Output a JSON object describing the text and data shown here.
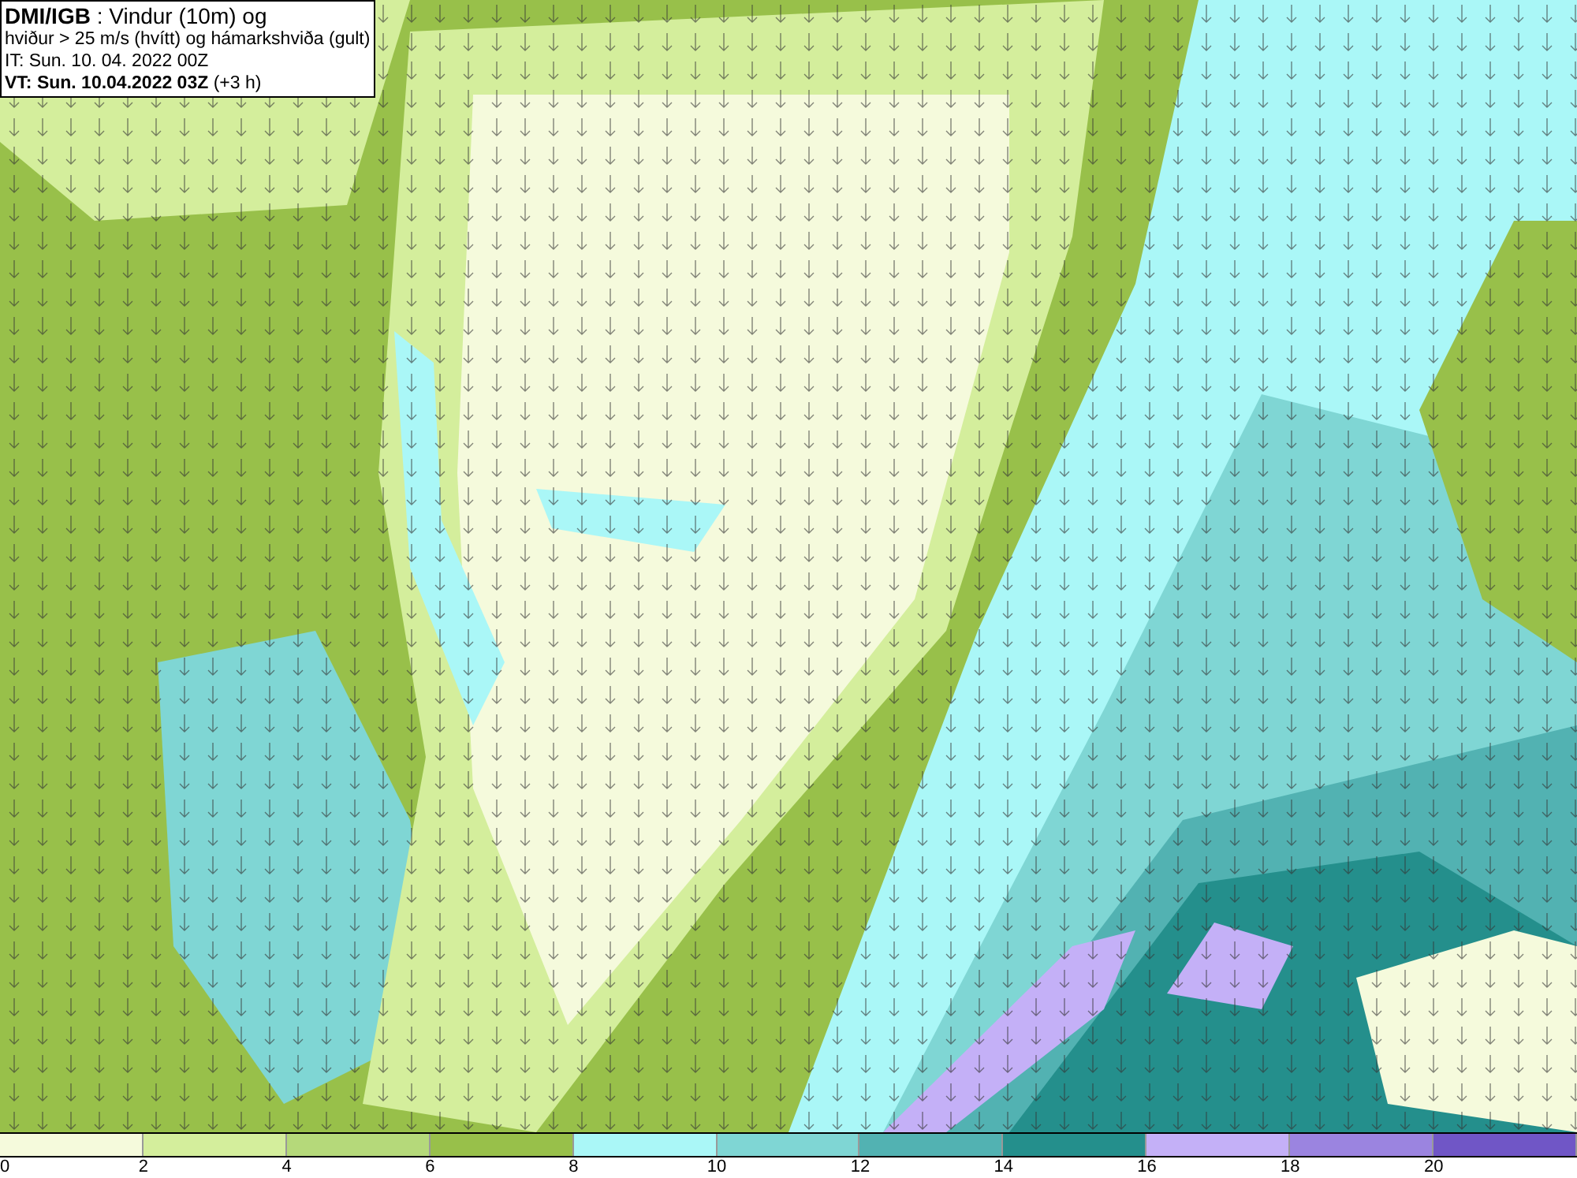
{
  "title_box": {
    "lines": [
      "**DMI/IGB** : Vindur (10m) og",
      "hviður > 25 m/s (hvítt) og hámarkshviða (gult)",
      "IT: Sun. 10. 04. 2022 00Z",
      "**VT: Sun. 10.04.2022 03Z** (+3 h)"
    ]
  },
  "legend": {
    "segments": [
      {
        "color": "#f5fadc"
      },
      {
        "color": "#d4ee9c"
      },
      {
        "color": "#b5d97a"
      },
      {
        "color": "#98c04a"
      },
      {
        "color": "#aaf7f7"
      },
      {
        "color": "#7fd6d4"
      },
      {
        "color": "#52b2b2"
      },
      {
        "color": "#248f8c"
      },
      {
        "color": "#c4b0f7"
      },
      {
        "color": "#9b84e0"
      },
      {
        "color": "#7056c6"
      }
    ],
    "ticks": [
      "0",
      "2",
      "4",
      "6",
      "8",
      "10",
      "12",
      "14",
      "16",
      "18",
      "20"
    ]
  }
}
